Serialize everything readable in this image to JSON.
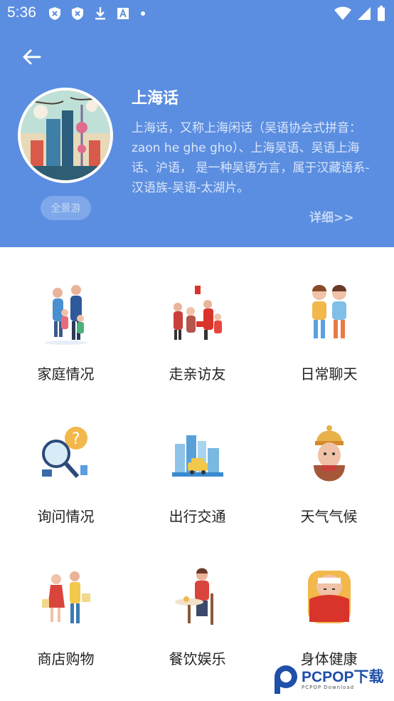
{
  "status": {
    "time": "5:36"
  },
  "header": {
    "title": "上海话",
    "description": "上海话，又称上海闲话（吴语协会式拼音：zaon he ghe gho）、上海吴语、吴语上海话、沪语， 是一种吴语方言，属于汉藏语系-汉语族-吴语-太湖片。",
    "tag": "全景游",
    "detail_link": "详细>>"
  },
  "grid": {
    "items": [
      {
        "label": "家庭情况",
        "icon": "family-illustration"
      },
      {
        "label": "走亲访友",
        "icon": "visiting-relatives-illustration"
      },
      {
        "label": "日常聊天",
        "icon": "chatting-kids-illustration"
      },
      {
        "label": "询问情况",
        "icon": "magnifier-question-illustration"
      },
      {
        "label": "出行交通",
        "icon": "city-taxi-illustration"
      },
      {
        "label": "天气气候",
        "icon": "cold-weather-illustration"
      },
      {
        "label": "商店购物",
        "icon": "shopping-illustration"
      },
      {
        "label": "餐饮娱乐",
        "icon": "dining-illustration"
      },
      {
        "label": "身体健康",
        "icon": "sick-in-bed-illustration"
      }
    ]
  },
  "watermark": {
    "brand": "PCPOP下载",
    "sub": "PCPOP Download"
  },
  "colors": {
    "header_bg": "#5b8ee0",
    "title": "#ffffff",
    "label": "#222222"
  }
}
